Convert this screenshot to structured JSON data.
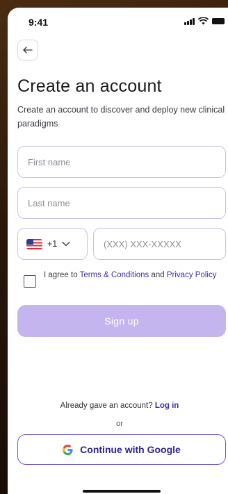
{
  "status_bar": {
    "time": "9:41"
  },
  "header": {
    "title": "Create an account",
    "subtitle": "Create an account to discover and deploy new clinical paradigms"
  },
  "form": {
    "first_name_placeholder": "First name",
    "last_name_placeholder": "Last name",
    "country_code": "+1",
    "phone_placeholder": "(XXX) XXX-XXXXX",
    "terms_prefix": "I agree to ",
    "terms_link": "Terms & Conditions",
    "terms_middle": " and ",
    "privacy_link": "Privacy Policy",
    "terms_checked": false,
    "signup_label": "Sign up"
  },
  "footer": {
    "already_text": "Already gave an account? ",
    "login_link": "Log in",
    "or_text": "or",
    "google_label": "Continue with Google"
  },
  "colors": {
    "accent": "#3b2fb0",
    "signup_disabled": "#c4b5ef",
    "field_border": "#c9c0ef"
  },
  "icons": {
    "back": "arrow-left-icon",
    "flag": "us-flag-icon",
    "dropdown": "chevron-down-icon",
    "google": "google-icon"
  }
}
